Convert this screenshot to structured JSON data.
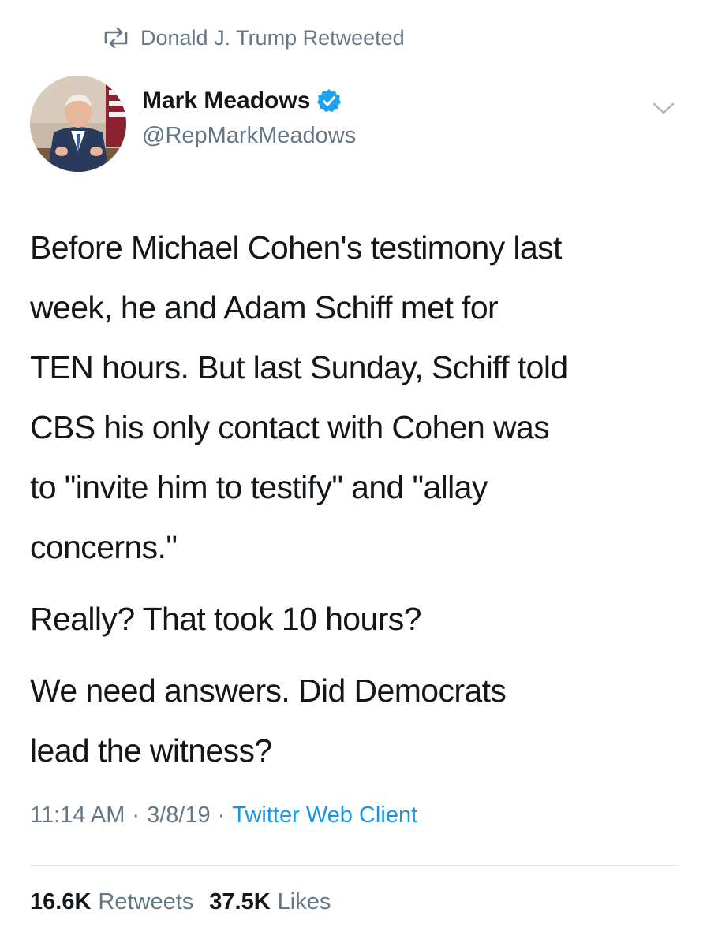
{
  "retweet_header": {
    "icon": "retweet-icon",
    "text": "Donald J. Trump Retweeted"
  },
  "author": {
    "display_name": "Mark Meadows",
    "handle": "@RepMarkMeadows",
    "verified": true,
    "avatar_icon": "avatar"
  },
  "tweet": {
    "paragraphs": [
      "Before Michael Cohen's testimony last\nweek, he and Adam Schiff met for\nTEN hours. But last Sunday, Schiff told\nCBS his only contact with Cohen was\nto \"invite him to testify\" and \"allay\nconcerns.\"",
      "Really? That took 10 hours?",
      "We need answers. Did Democrats\nlead the witness?"
    ]
  },
  "meta": {
    "time": "11:14 AM",
    "separator": "·",
    "date": "3/8/19",
    "client": "Twitter Web Client"
  },
  "stats": {
    "retweets_count": "16.6K",
    "retweets_label": "Retweets",
    "likes_count": "37.5K",
    "likes_label": "Likes"
  },
  "colors": {
    "text": "#14171a",
    "secondary": "#657786",
    "link": "#1b95e0",
    "verified": "#1da1f2",
    "divider": "#e1e8ed"
  }
}
